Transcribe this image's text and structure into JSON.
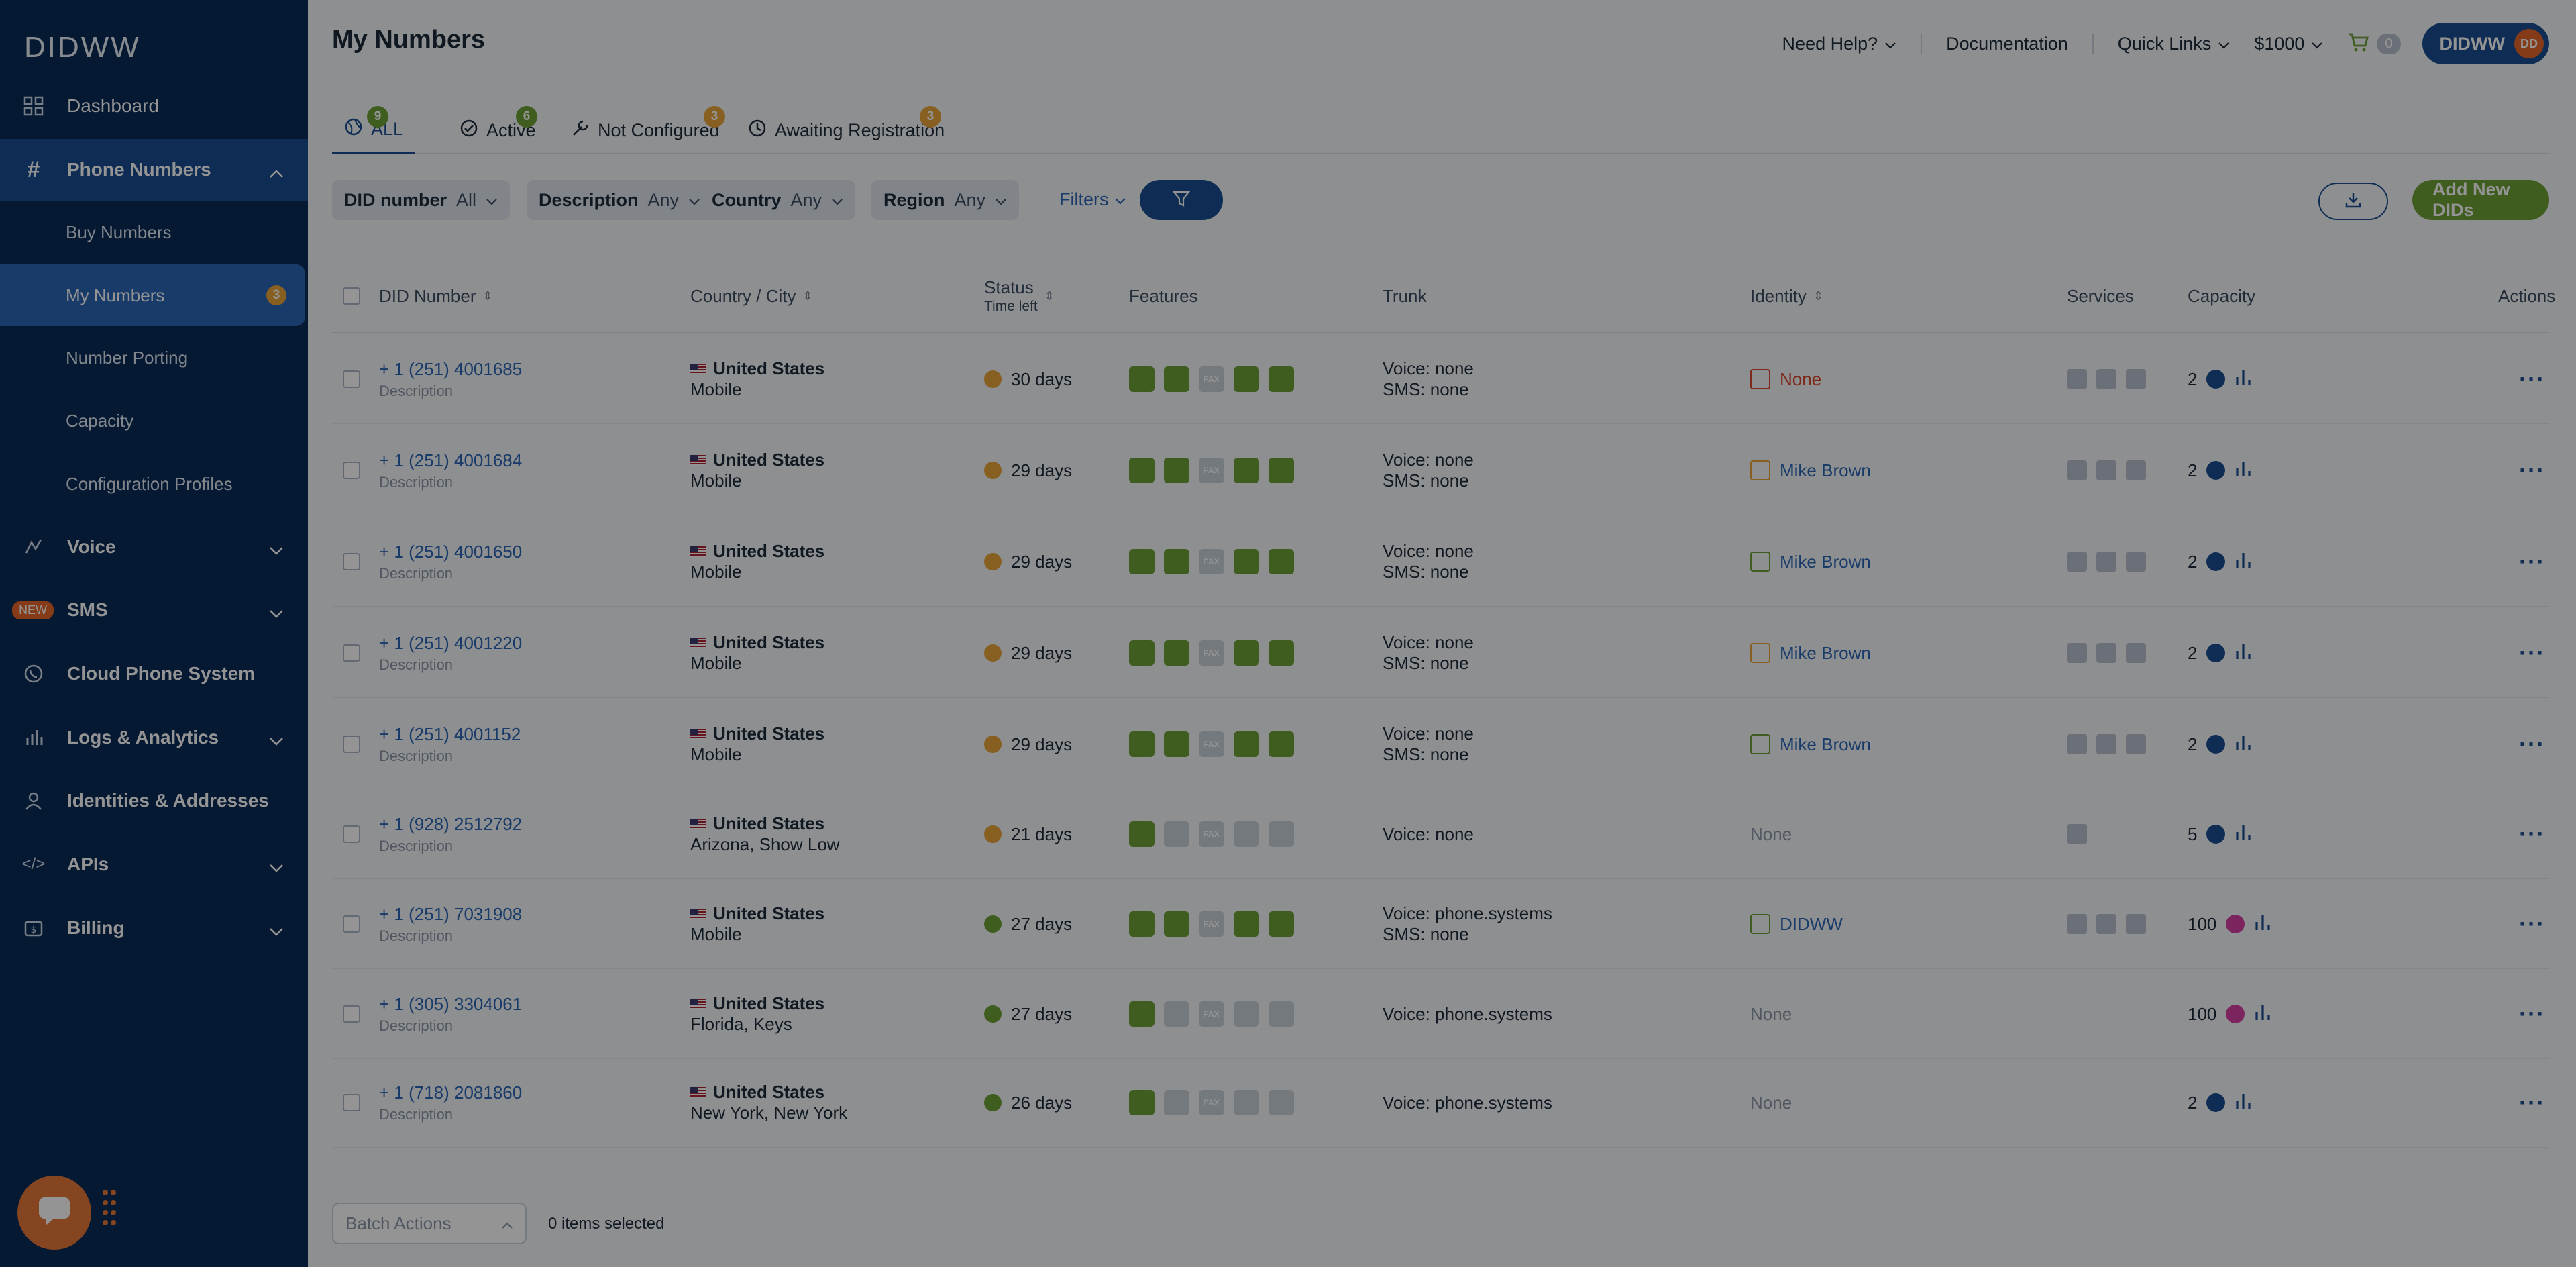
{
  "brand": {
    "logo": "DIDWW"
  },
  "sidebar": {
    "dashboard": "Dashboard",
    "phone_numbers": "Phone Numbers",
    "sub": {
      "buy": "Buy Numbers",
      "my": "My Numbers",
      "my_badge": "3",
      "porting": "Number Porting",
      "capacity": "Capacity",
      "config": "Configuration Profiles"
    },
    "voice": "Voice",
    "sms_new": "NEW",
    "sms": "SMS",
    "cloud": "Cloud Phone System",
    "logs": "Logs & Analytics",
    "identities": "Identities & Addresses",
    "apis": "APIs",
    "billing": "Billing"
  },
  "header": {
    "title": "My Numbers",
    "need_help": "Need Help?",
    "documentation": "Documentation",
    "quick_links": "Quick Links",
    "balance": "$1000",
    "cart_count": "0",
    "account": "DIDWW",
    "avatar_initials": "DD"
  },
  "tabs": [
    {
      "label": "ALL",
      "count": "9",
      "color": "#6fa037"
    },
    {
      "label": "Active",
      "count": "6",
      "color": "#6fa037"
    },
    {
      "label": "Not Configured",
      "count": "3",
      "color": "#e8a43a"
    },
    {
      "label": "Awaiting Registration",
      "count": "3",
      "color": "#e8a43a"
    }
  ],
  "filters": {
    "did_label": "DID number",
    "did_value": "All",
    "desc_label": "Description",
    "desc_value": "Any",
    "country_label": "Country",
    "country_value": "Any",
    "region_label": "Region",
    "region_value": "Any",
    "filters_link": "Filters",
    "add_button": "Add New DIDs"
  },
  "columns": {
    "did": "DID Number",
    "country": "Country / City",
    "status": "Status",
    "time_left": "Time left",
    "features": "Features",
    "trunk": "Trunk",
    "identity": "Identity",
    "services": "Services",
    "capacity": "Capacity",
    "actions": "Actions"
  },
  "colors": {
    "orange": "#e8a43a",
    "green": "#6fa037",
    "blue": "#1b4e92",
    "magenta": "#d63fa3",
    "red": "#d9472b",
    "accent": "#2b66b5"
  },
  "rows": [
    {
      "did": "+ 1 (251) 4001685",
      "desc": "Description",
      "country": "United States",
      "city": "Mobile",
      "status": "30 days",
      "status_color": "#e8a43a",
      "features": [
        1,
        1,
        0,
        1,
        1
      ],
      "trunk_voice": "Voice: none",
      "trunk_sms": "SMS: none",
      "identity": "None",
      "identity_color": "#d9472b",
      "identity_link": true,
      "services": 3,
      "capacity": "2",
      "cap_color": "#1b4e92"
    },
    {
      "did": "+ 1 (251) 4001684",
      "desc": "Description",
      "country": "United States",
      "city": "Mobile",
      "status": "29 days",
      "status_color": "#e8a43a",
      "features": [
        1,
        1,
        0,
        1,
        1
      ],
      "trunk_voice": "Voice: none",
      "trunk_sms": "SMS: none",
      "identity": "Mike Brown",
      "identity_color": "#e8a43a",
      "identity_link": true,
      "services": 3,
      "capacity": "2",
      "cap_color": "#1b4e92"
    },
    {
      "did": "+ 1 (251) 4001650",
      "desc": "Description",
      "country": "United States",
      "city": "Mobile",
      "status": "29 days",
      "status_color": "#e8a43a",
      "features": [
        1,
        1,
        0,
        1,
        1
      ],
      "trunk_voice": "Voice: none",
      "trunk_sms": "SMS: none",
      "identity": "Mike Brown",
      "identity_color": "#6fa037",
      "identity_link": true,
      "services": 3,
      "capacity": "2",
      "cap_color": "#1b4e92"
    },
    {
      "did": "+ 1 (251) 4001220",
      "desc": "Description",
      "country": "United States",
      "city": "Mobile",
      "status": "29 days",
      "status_color": "#e8a43a",
      "features": [
        1,
        1,
        0,
        1,
        1
      ],
      "trunk_voice": "Voice: none",
      "trunk_sms": "SMS: none",
      "identity": "Mike Brown",
      "identity_color": "#e8a43a",
      "identity_link": true,
      "services": 3,
      "capacity": "2",
      "cap_color": "#1b4e92"
    },
    {
      "did": "+ 1 (251) 4001152",
      "desc": "Description",
      "country": "United States",
      "city": "Mobile",
      "status": "29 days",
      "status_color": "#e8a43a",
      "features": [
        1,
        1,
        0,
        1,
        1
      ],
      "trunk_voice": "Voice: none",
      "trunk_sms": "SMS: none",
      "identity": "Mike Brown",
      "identity_color": "#6fa037",
      "identity_link": true,
      "services": 3,
      "capacity": "2",
      "cap_color": "#1b4e92"
    },
    {
      "did": "+ 1 (928) 2512792",
      "desc": "Description",
      "country": "United States",
      "city": "Arizona, Show Low",
      "status": "21 days",
      "status_color": "#e8a43a",
      "features": [
        1,
        0,
        0,
        0,
        0
      ],
      "trunk_voice": "Voice: none",
      "trunk_sms": "",
      "identity": "None",
      "identity_color": "",
      "identity_link": false,
      "services": 1,
      "capacity": "5",
      "cap_color": "#1b4e92"
    },
    {
      "did": "+ 1 (251) 7031908",
      "desc": "Description",
      "country": "United States",
      "city": "Mobile",
      "status": "27 days",
      "status_color": "#6fa037",
      "features": [
        1,
        1,
        0,
        1,
        1
      ],
      "trunk_voice": "Voice: phone.systems",
      "trunk_sms": "SMS: none",
      "identity": "DIDWW",
      "identity_color": "#6fa037",
      "identity_link": true,
      "services": 3,
      "capacity": "100",
      "cap_color": "#d63fa3"
    },
    {
      "did": "+ 1 (305) 3304061",
      "desc": "Description",
      "country": "United States",
      "city": "Florida, Keys",
      "status": "27 days",
      "status_color": "#6fa037",
      "features": [
        1,
        0,
        0,
        0,
        0
      ],
      "trunk_voice": "Voice: phone.systems",
      "trunk_sms": "",
      "identity": "None",
      "identity_color": "",
      "identity_link": false,
      "services": 0,
      "capacity": "100",
      "cap_color": "#d63fa3"
    },
    {
      "did": "+ 1 (718) 2081860",
      "desc": "Description",
      "country": "United States",
      "city": "New York, New York",
      "status": "26 days",
      "status_color": "#6fa037",
      "features": [
        1,
        0,
        0,
        0,
        0
      ],
      "trunk_voice": "Voice: phone.systems",
      "trunk_sms": "",
      "identity": "None",
      "identity_color": "",
      "identity_link": false,
      "services": 0,
      "capacity": "2",
      "cap_color": "#1b4e92"
    }
  ],
  "footer": {
    "batch": "Batch Actions",
    "selected": "0 items selected"
  }
}
